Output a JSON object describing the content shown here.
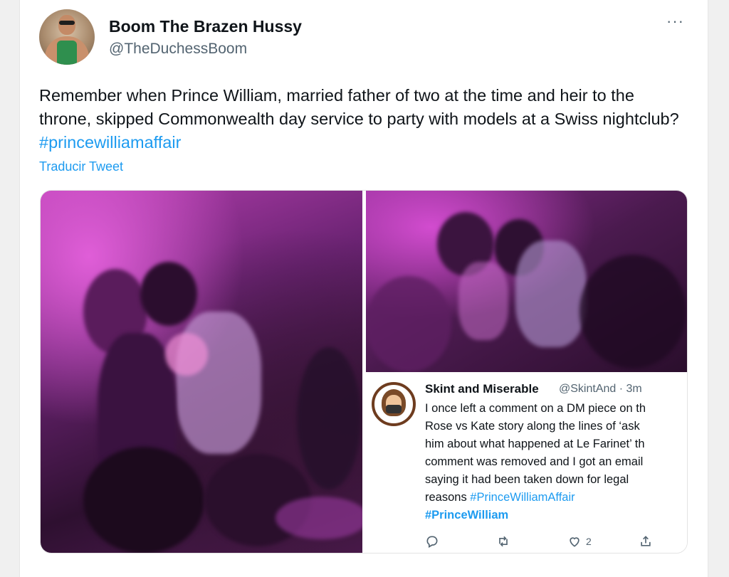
{
  "tweet": {
    "display_name": "Boom The Brazen Hussy",
    "handle": "@TheDuchessBoom",
    "more_label": "···",
    "text_plain": "Remember when Prince William, married father of two at the time and heir to the throne, skipped Commonwealth day service to party with models at a Swiss nightclub?",
    "hashtag": "#princewilliamaffair",
    "translate_label": "Traducir Tweet"
  },
  "embedded_screenshot": {
    "name": "Skint and Miserable",
    "meta": "@SkintAnd · 3m",
    "lines": [
      "I once left a comment on a DM piece on th",
      "Rose vs Kate story along the lines of ‘ask",
      "him about what happened at Le Farinet’ th",
      "comment was removed and I got an email",
      "saying it had been taken down for legal"
    ],
    "last_line_text": "reasons",
    "hashtag_1": "#PrinceWilliamAffair",
    "hashtag_2": "#PrinceWilliam",
    "like_count": "2",
    "icons": [
      "reply-icon",
      "retweet-icon",
      "like-icon",
      "share-icon"
    ]
  },
  "colors": {
    "accent": "#1d9bf0",
    "text": "#0f1419",
    "muted": "#536471"
  }
}
